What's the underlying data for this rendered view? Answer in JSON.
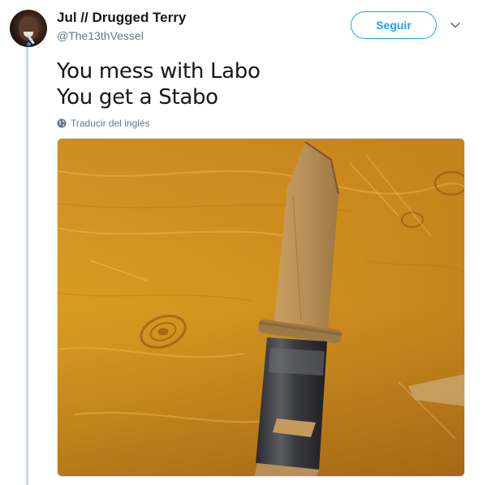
{
  "author": {
    "display_name": "Jul // Drugged Terry",
    "handle": "@The13thVessel",
    "avatar_icon": "profile-avatar"
  },
  "follow_button": {
    "label": "Seguir",
    "color": "#1da1f2"
  },
  "menu": {
    "icon": "chevron-down-icon"
  },
  "tweet": {
    "lines": [
      "You mess with Labo",
      "You get a Stabo"
    ]
  },
  "translate": {
    "label": "Traducir del inglés",
    "icon": "globe-icon"
  },
  "media": {
    "type": "photo",
    "subject": "cardboard knife with duct-tape handle on wooden table"
  },
  "colors": {
    "thread_line": "#c4dbea",
    "secondary_text": "#657786",
    "primary_text": "#14171a"
  }
}
